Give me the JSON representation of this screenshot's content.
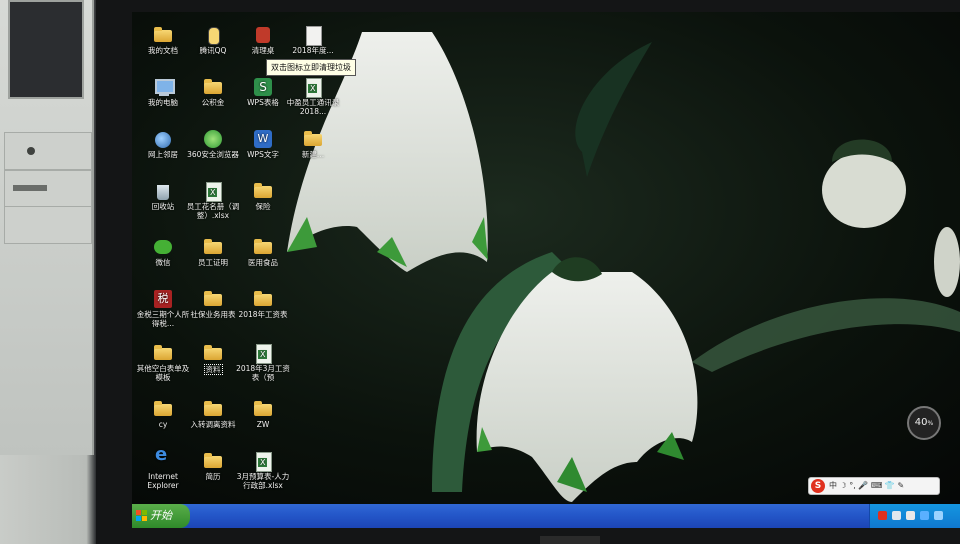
{
  "desktop": {
    "icons": [
      {
        "label": "我的文档",
        "icon": "documents-folder-icon"
      },
      {
        "label": "腾讯QQ",
        "icon": "qq-penguin-icon"
      },
      {
        "label": "清理桌",
        "icon": "cleanup-icon"
      },
      {
        "label": "2018年度...",
        "icon": "document-icon"
      },
      {
        "label": "我的电脑",
        "icon": "computer-icon"
      },
      {
        "label": "公积金",
        "icon": "folder-icon"
      },
      {
        "label": "WPS表格",
        "icon": "wps-spreadsheet-icon"
      },
      {
        "label": "中盈员工通讯录2018...",
        "icon": "excel-file-icon"
      },
      {
        "label": "网上邻居",
        "icon": "network-places-icon"
      },
      {
        "label": "360安全浏览器",
        "icon": "360-browser-icon"
      },
      {
        "label": "WPS文字",
        "icon": "wps-writer-icon"
      },
      {
        "label": "新建...",
        "icon": "folder-icon"
      },
      {
        "label": "回收站",
        "icon": "recycle-bin-icon"
      },
      {
        "label": "员工花名册（调整）.xlsx",
        "icon": "excel-file-icon"
      },
      {
        "label": "保险",
        "icon": "folder-icon"
      },
      {
        "label": "微信",
        "icon": "wechat-icon"
      },
      {
        "label": "员工证明",
        "icon": "folder-icon"
      },
      {
        "label": "医用食品",
        "icon": "folder-icon"
      },
      {
        "label": "金税三期个人所得税...",
        "icon": "tax-client-icon"
      },
      {
        "label": "社保业务用表",
        "icon": "folder-icon"
      },
      {
        "label": "2018年工资表",
        "icon": "folder-icon"
      },
      {
        "label": "其他空白表单及模板",
        "icon": "folder-icon"
      },
      {
        "label": "资料",
        "icon": "folder-icon"
      },
      {
        "label": "2018年3月工资表（预",
        "icon": "excel-file-icon"
      },
      {
        "label": "cy",
        "icon": "folder-icon"
      },
      {
        "label": "入转调离资料",
        "icon": "folder-icon"
      },
      {
        "label": "ZW",
        "icon": "folder-icon"
      },
      {
        "label": "Internet Explorer",
        "icon": "internet-explorer-icon"
      },
      {
        "label": "简历",
        "icon": "folder-icon"
      },
      {
        "label": "3月预算表-人力行政部.xlsx",
        "icon": "excel-file-icon"
      }
    ],
    "tooltip": "双击图标立即清理垃圾"
  },
  "taskbar": {
    "start_label": "开始",
    "ime_logo": "S",
    "ime_text": "中 ☽ °, 🎤 ⌨ 👕 ✎"
  },
  "overlay": {
    "speed_value": "40",
    "speed_unit": "%"
  },
  "colors": {
    "taskbar_blue": "#2457c9",
    "start_green": "#3f9a35",
    "tray_blue": "#1189da"
  }
}
